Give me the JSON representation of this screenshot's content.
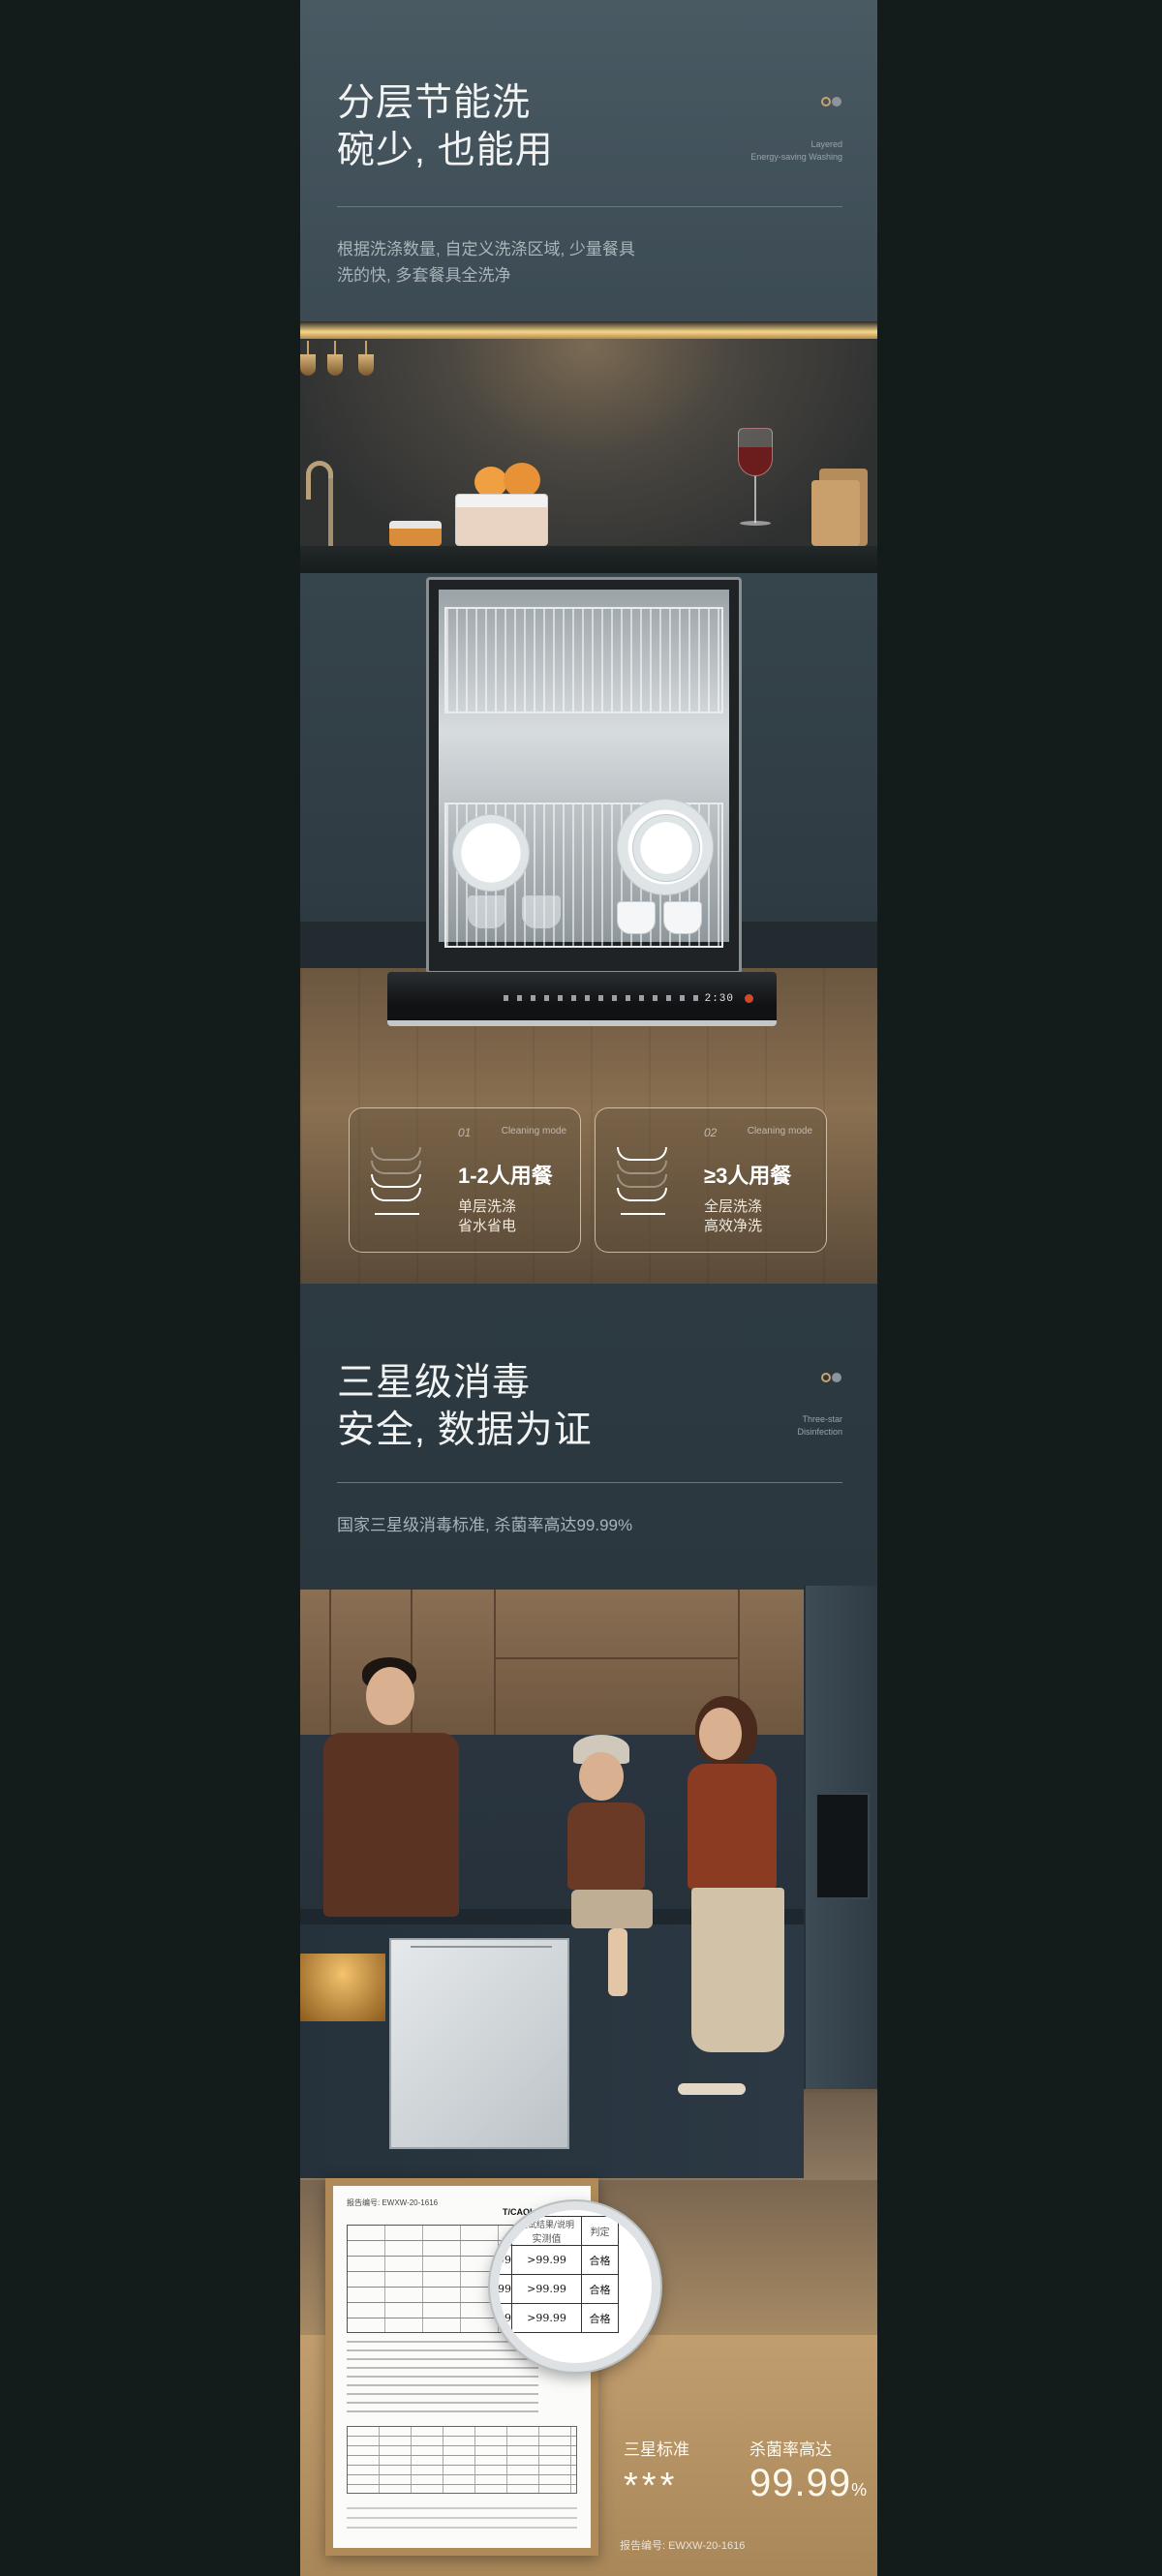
{
  "section1": {
    "title_line1": "分层节能洗",
    "title_line2": "碗少, 也能用",
    "en_line1": "Layered",
    "en_line2": "Energy-saving Washing",
    "desc_line1": "根据洗涤数量, 自定义洗涤区域, 少量餐具",
    "desc_line2": "洗的快, 多套餐具全洗净"
  },
  "dishwasher_panel": {
    "display": "2:30"
  },
  "modes": [
    {
      "num": "01",
      "mode_label": "Cleaning mode",
      "title": "1-2人用餐",
      "line1": "单层洗涤",
      "line2": "省水省电"
    },
    {
      "num": "02",
      "mode_label": "Cleaning mode",
      "title": "≥3人用餐",
      "line1": "全层洗涤",
      "line2": "高效净洗"
    }
  ],
  "section2": {
    "title_line1": "三星级消毒",
    "title_line2": "安全, 数据为证",
    "en_line1": "Three-star",
    "en_line2": "Disinfection",
    "desc": "国家三星级消毒标准, 杀菌率高达99.99%"
  },
  "certificate": {
    "report_header": "报告编号: EWXW-20-1616",
    "standard": "T/CAQI 106-2020",
    "magnifier": {
      "col_header_result": "实测值",
      "col_header_verdict": "判定",
      "col_header_top": "测试结果/说明",
      "rows": [
        {
          "left": "99",
          "value": ">99.99",
          "verdict": "合格"
        },
        {
          "left": "99",
          "value": ">99.99",
          "verdict": "合格"
        },
        {
          "left": "99",
          "value": ">99.99",
          "verdict": "合格"
        }
      ]
    }
  },
  "stats": {
    "star_label": "三星标准",
    "star_value": "***",
    "rate_label": "杀菌率高达",
    "rate_value": "99.99",
    "rate_unit": "%",
    "report_no": "报告编号: EWXW-20-1616"
  }
}
